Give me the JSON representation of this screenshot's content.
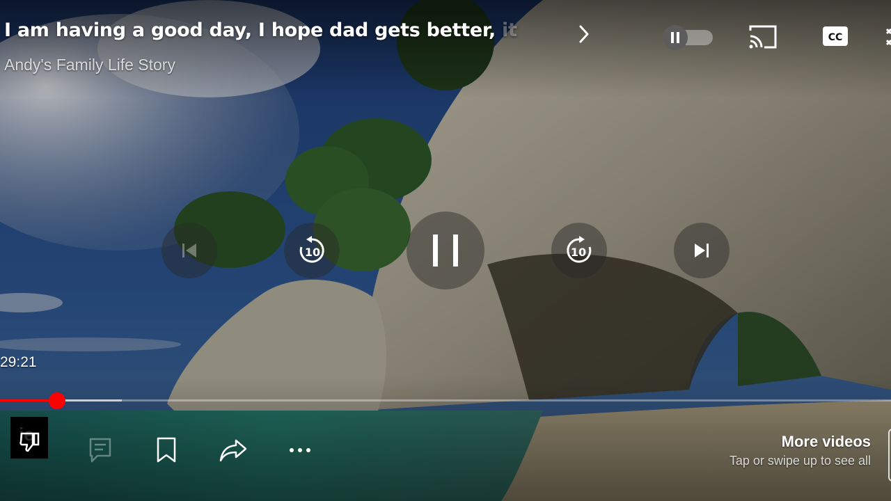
{
  "video": {
    "title_main": "I am having a good day, I hope dad gets better, ",
    "title_faded": "it",
    "channel": "Andy's Family Life Story",
    "elapsed_time": "29:21"
  },
  "progress": {
    "played_fraction": 0.064,
    "buffered_fraction": 0.137
  },
  "controls": {
    "autoplay_icon": "pause-icon",
    "cast_icon": "cast-icon",
    "captions_label": "CC",
    "skip_seconds_back": "10",
    "skip_seconds_forward": "10"
  },
  "more_videos": {
    "title": "More videos",
    "hint": "Tap or swipe up to see all"
  },
  "colors": {
    "progress_played": "#ff0000",
    "progress_thumb": "#ff0000"
  }
}
